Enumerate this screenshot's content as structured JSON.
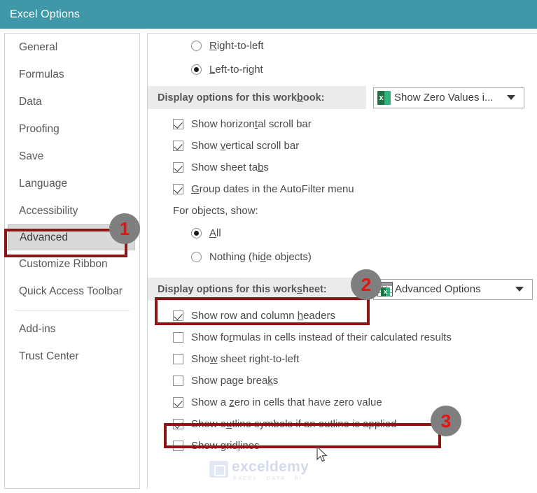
{
  "window": {
    "title": "Excel Options",
    "titlebar_color": "#3f98a8"
  },
  "sidebar": {
    "items": [
      {
        "label": "General",
        "selected": false,
        "separator_after": false
      },
      {
        "label": "Formulas",
        "selected": false,
        "separator_after": false
      },
      {
        "label": "Data",
        "selected": false,
        "separator_after": false
      },
      {
        "label": "Proofing",
        "selected": false,
        "separator_after": false
      },
      {
        "label": "Save",
        "selected": false,
        "separator_after": false
      },
      {
        "label": "Language",
        "selected": false,
        "separator_after": false
      },
      {
        "label": "Accessibility",
        "selected": false,
        "separator_after": false
      },
      {
        "label": "Advanced",
        "selected": true,
        "separator_after": false
      },
      {
        "label": "Customize Ribbon",
        "selected": false,
        "separator_after": false
      },
      {
        "label": "Quick Access Toolbar",
        "selected": false,
        "separator_after": true
      },
      {
        "label": "Add-ins",
        "selected": false,
        "separator_after": false
      },
      {
        "label": "Trust Center",
        "selected": false,
        "separator_after": false
      }
    ]
  },
  "content": {
    "direction_radios": [
      {
        "label_pre": "",
        "accel": "R",
        "label_post": "ight-to-left",
        "checked": false
      },
      {
        "label_pre": "",
        "accel": "L",
        "label_post": "eft-to-right",
        "checked": true
      }
    ],
    "workbook_section": {
      "label_pre": "Display options for this work",
      "accel": "b",
      "label_post": "ook:",
      "dropdown_value": "Show Zero Values i...",
      "dropdown_icon": "excel-workbook-icon"
    },
    "workbook_checkboxes": [
      {
        "label_pre": "Show horizon",
        "accel": "t",
        "label_post": "al scroll bar",
        "checked": true
      },
      {
        "label_pre": "Show ",
        "accel": "v",
        "label_post": "ertical scroll bar",
        "checked": true
      },
      {
        "label_pre": "Show sheet ta",
        "accel": "b",
        "label_post": "s",
        "checked": true
      },
      {
        "label_pre": "",
        "accel": "G",
        "label_post": "roup dates in the AutoFilter menu",
        "checked": true
      }
    ],
    "objects_group_label": "For objects, show:",
    "objects_radios": [
      {
        "label_pre": "",
        "accel": "A",
        "label_post": "ll",
        "checked": true
      },
      {
        "label_pre": "Nothing (hi",
        "accel": "d",
        "label_post": "e objects)",
        "checked": false
      }
    ],
    "worksheet_section": {
      "label_pre": "Display options for this work",
      "accel": "s",
      "label_post": "heet:",
      "dropdown_value": "Advanced Options",
      "dropdown_icon": "excel-worksheet-icon"
    },
    "worksheet_checkboxes": [
      {
        "label_pre": "Show row and column ",
        "accel": "h",
        "label_post": "eaders",
        "checked": true
      },
      {
        "label_pre": "Show fo",
        "accel": "r",
        "label_post": "mulas in cells instead of their calculated results",
        "checked": false
      },
      {
        "label_pre": "Sho",
        "accel": "w",
        "label_post": " sheet right-to-left",
        "checked": false
      },
      {
        "label_pre": "Show page brea",
        "accel": "k",
        "label_post": "s",
        "checked": false
      },
      {
        "label_pre": "Show a ",
        "accel": "z",
        "label_post": "ero in cells that have zero value",
        "checked": true
      },
      {
        "label_pre": "Show o",
        "accel": "u",
        "label_post": "tline symbols if an outline is applied",
        "checked": true
      },
      {
        "label_pre": "Show grid",
        "accel": "l",
        "label_post": "ines",
        "checked": false
      }
    ]
  },
  "annotations": {
    "highlight_color": "#8c1616",
    "badge_bg": "#7f7f7f",
    "badge_fg": "#e8120f",
    "steps": [
      {
        "number": "1",
        "targets": "sidebar-item-advanced"
      },
      {
        "number": "2",
        "targets": "worksheet-section-label"
      },
      {
        "number": "3",
        "targets": "checkbox-show-a-zero"
      }
    ]
  },
  "watermark": {
    "main": "exceldemy",
    "sub": "EXCEL · DATA · BI"
  }
}
